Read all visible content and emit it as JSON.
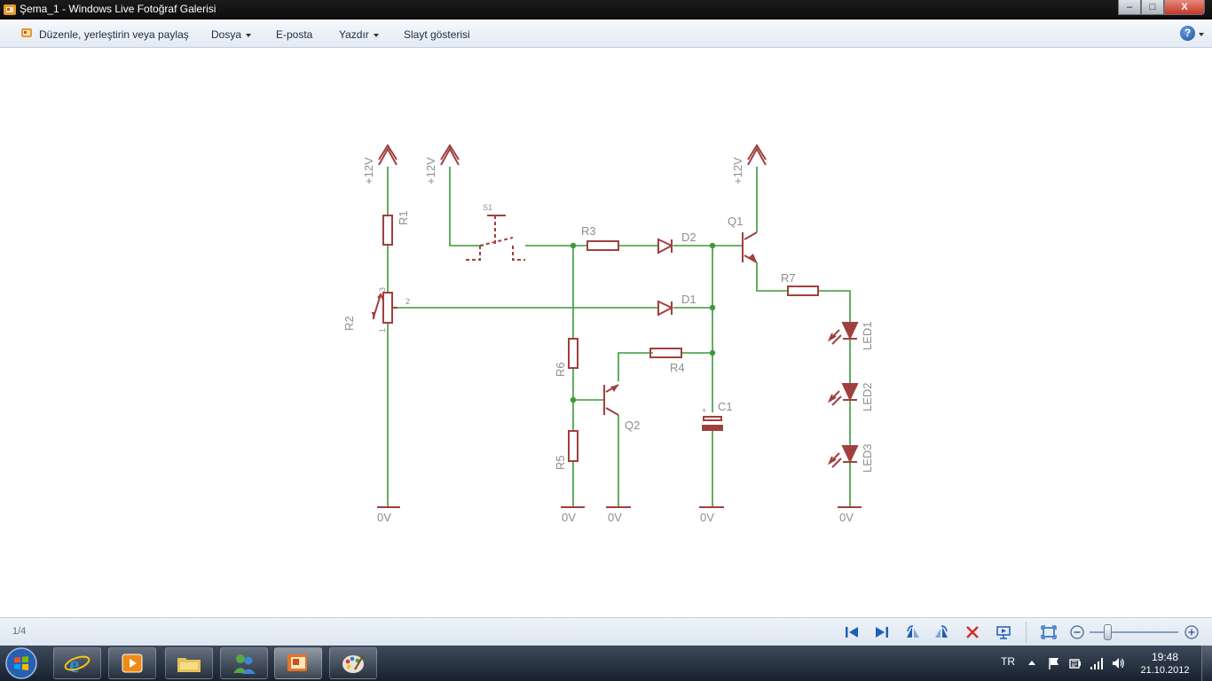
{
  "window": {
    "title": "Şema_1 - Windows Live Fotoğraf Galerisi",
    "buttons": {
      "minimize": "–",
      "maximize": "□",
      "close": "X"
    }
  },
  "menu": {
    "organize": "Düzenle, yerleştirin veya paylaş",
    "file": "Dosya",
    "email": "E-posta",
    "print": "Yazdır",
    "slideshow": "Slayt gösterisi",
    "help": "?"
  },
  "schematic": {
    "supply": "+12V",
    "ground": "0V",
    "components": {
      "R1": "R1",
      "R2": "R2",
      "R3": "R3",
      "R4": "R4",
      "R5": "R5",
      "R6": "R6",
      "R7": "R7",
      "S1": "S1",
      "D1": "D1",
      "D2": "D2",
      "Q1": "Q1",
      "Q2": "Q2",
      "C1": "C1",
      "LED1": "LED1",
      "LED2": "LED2",
      "LED3": "LED3"
    },
    "pins": {
      "p1": "1",
      "p2": "2",
      "p3": "3",
      "plus": "+"
    },
    "colors": {
      "wire": "#3c9a3c",
      "part": "#a0403e",
      "label": "#8e8e8e"
    }
  },
  "viewer": {
    "counter": "1/4",
    "zoom_level": 0.2
  },
  "taskbar": {
    "language": "TR",
    "time": "19:48",
    "date": "21.10.2012",
    "pinned_icons": [
      "internet-explorer-icon",
      "media-player-icon",
      "explorer-icon",
      "messenger-icon",
      "photo-gallery-icon",
      "paint-icon"
    ]
  }
}
